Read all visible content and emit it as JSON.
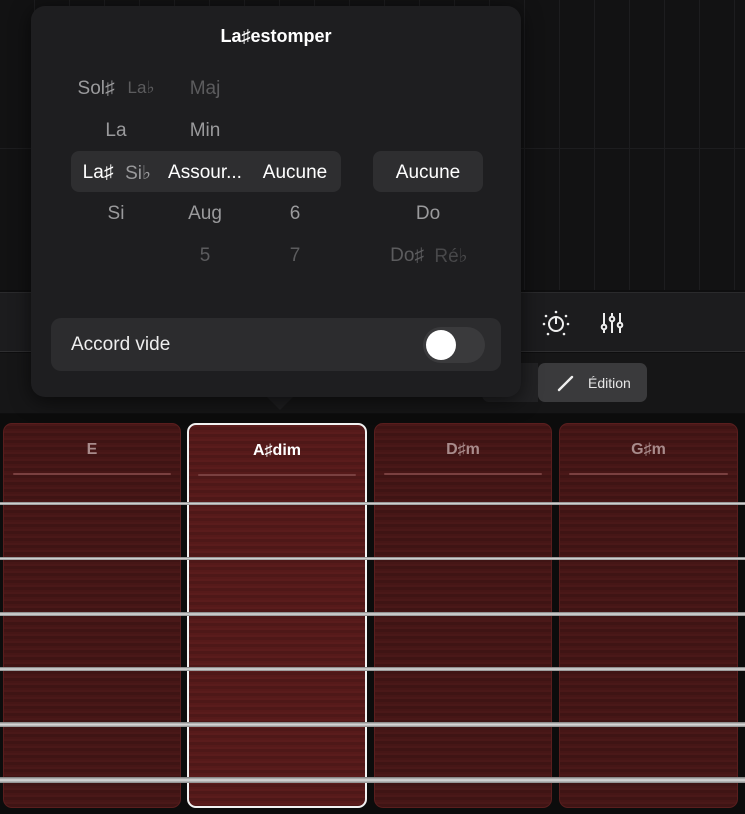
{
  "popover": {
    "title": "La♯estomper",
    "picker": {
      "root": {
        "above2": [
          "Sol♯",
          "La♭"
        ],
        "above1": "La",
        "selected": [
          "La♯",
          "Si♭"
        ],
        "below1": "Si"
      },
      "quality": {
        "above2": "Maj",
        "above1": "Min",
        "selected": "Assour...",
        "below1": "Aug",
        "below2": "5"
      },
      "extension": {
        "selected": "Aucune",
        "below1": "6",
        "below2": "7"
      },
      "bass": {
        "selected": "Aucune",
        "below1": "Do",
        "below2": [
          "Do♯",
          "Ré♭"
        ]
      }
    },
    "toggle_label": "Accord vide",
    "toggle_on": false
  },
  "toolbar": {
    "edit_label": "Édition"
  },
  "chords": [
    {
      "name": "E",
      "selected": false
    },
    {
      "name": "A♯dim",
      "selected": true
    },
    {
      "name": "D♯m",
      "selected": false
    },
    {
      "name": "G♯m",
      "selected": false
    }
  ]
}
